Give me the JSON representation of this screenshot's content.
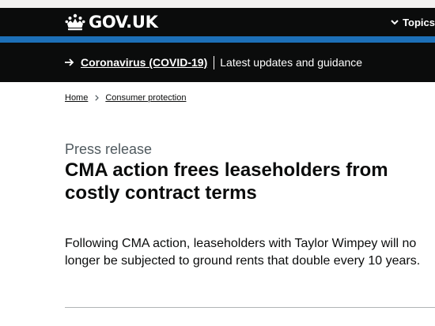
{
  "header": {
    "logo_text": "GOV.UK",
    "menu_label": "Topics"
  },
  "banner": {
    "link_text": "Coronavirus (COVID-19)",
    "text": "Latest updates and guidance"
  },
  "breadcrumbs": [
    {
      "label": "Home"
    },
    {
      "label": "Consumer protection"
    }
  ],
  "article": {
    "type_label": "Press release",
    "title": "CMA action frees leaseholders from costly contract terms",
    "lead": "Following CMA action, leaseholders with Taylor Wimpey will no longer be subjected to ground rents that double every 10 years."
  },
  "icons": {
    "logo": "crown-icon",
    "menu": "chevron-down-icon",
    "banner": "arrow-right-icon",
    "breadcrumb_separator": "chevron-right-icon"
  },
  "colors": {
    "header_background": "#0b0c0c",
    "header_border": "#1d70b8",
    "text": "#0b0c0c",
    "secondary_text": "#505a5f",
    "rule": "#b1b4b6"
  }
}
